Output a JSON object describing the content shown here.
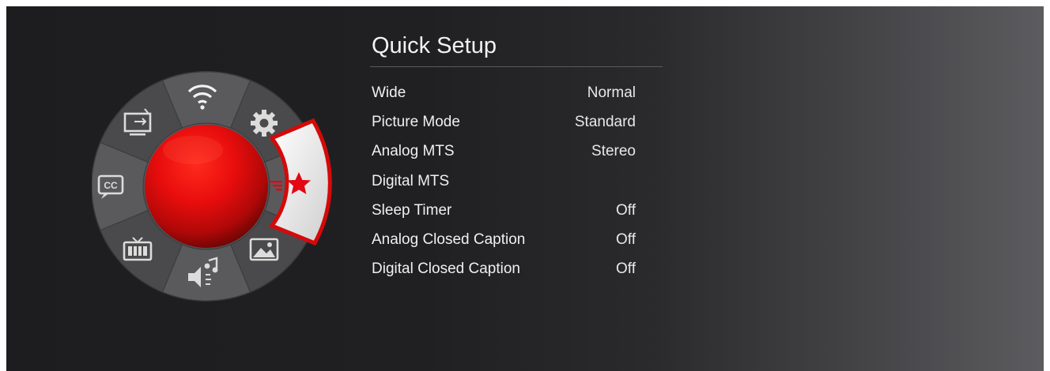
{
  "wheel": {
    "segments": [
      {
        "icon": "wifi-icon"
      },
      {
        "icon": "gear-icon"
      },
      {
        "icon": "star-icon"
      },
      {
        "icon": "picture-icon"
      },
      {
        "icon": "music-speaker-icon"
      },
      {
        "icon": "tv-channels-icon"
      },
      {
        "icon": "cc-icon"
      },
      {
        "icon": "tv-input-icon"
      }
    ],
    "selected_icon": "star-icon",
    "accent_color": "#e30613",
    "cc_text": "CC"
  },
  "panel": {
    "title": "Quick Setup",
    "items": [
      {
        "label": "Wide",
        "value": "Normal"
      },
      {
        "label": "Picture Mode",
        "value": "Standard"
      },
      {
        "label": "Analog MTS",
        "value": "Stereo"
      },
      {
        "label": "Digital MTS",
        "value": ""
      },
      {
        "label": "Sleep Timer",
        "value": "Off"
      },
      {
        "label": "Analog Closed Caption",
        "value": "Off"
      },
      {
        "label": "Digital Closed Caption",
        "value": "Off"
      }
    ]
  }
}
